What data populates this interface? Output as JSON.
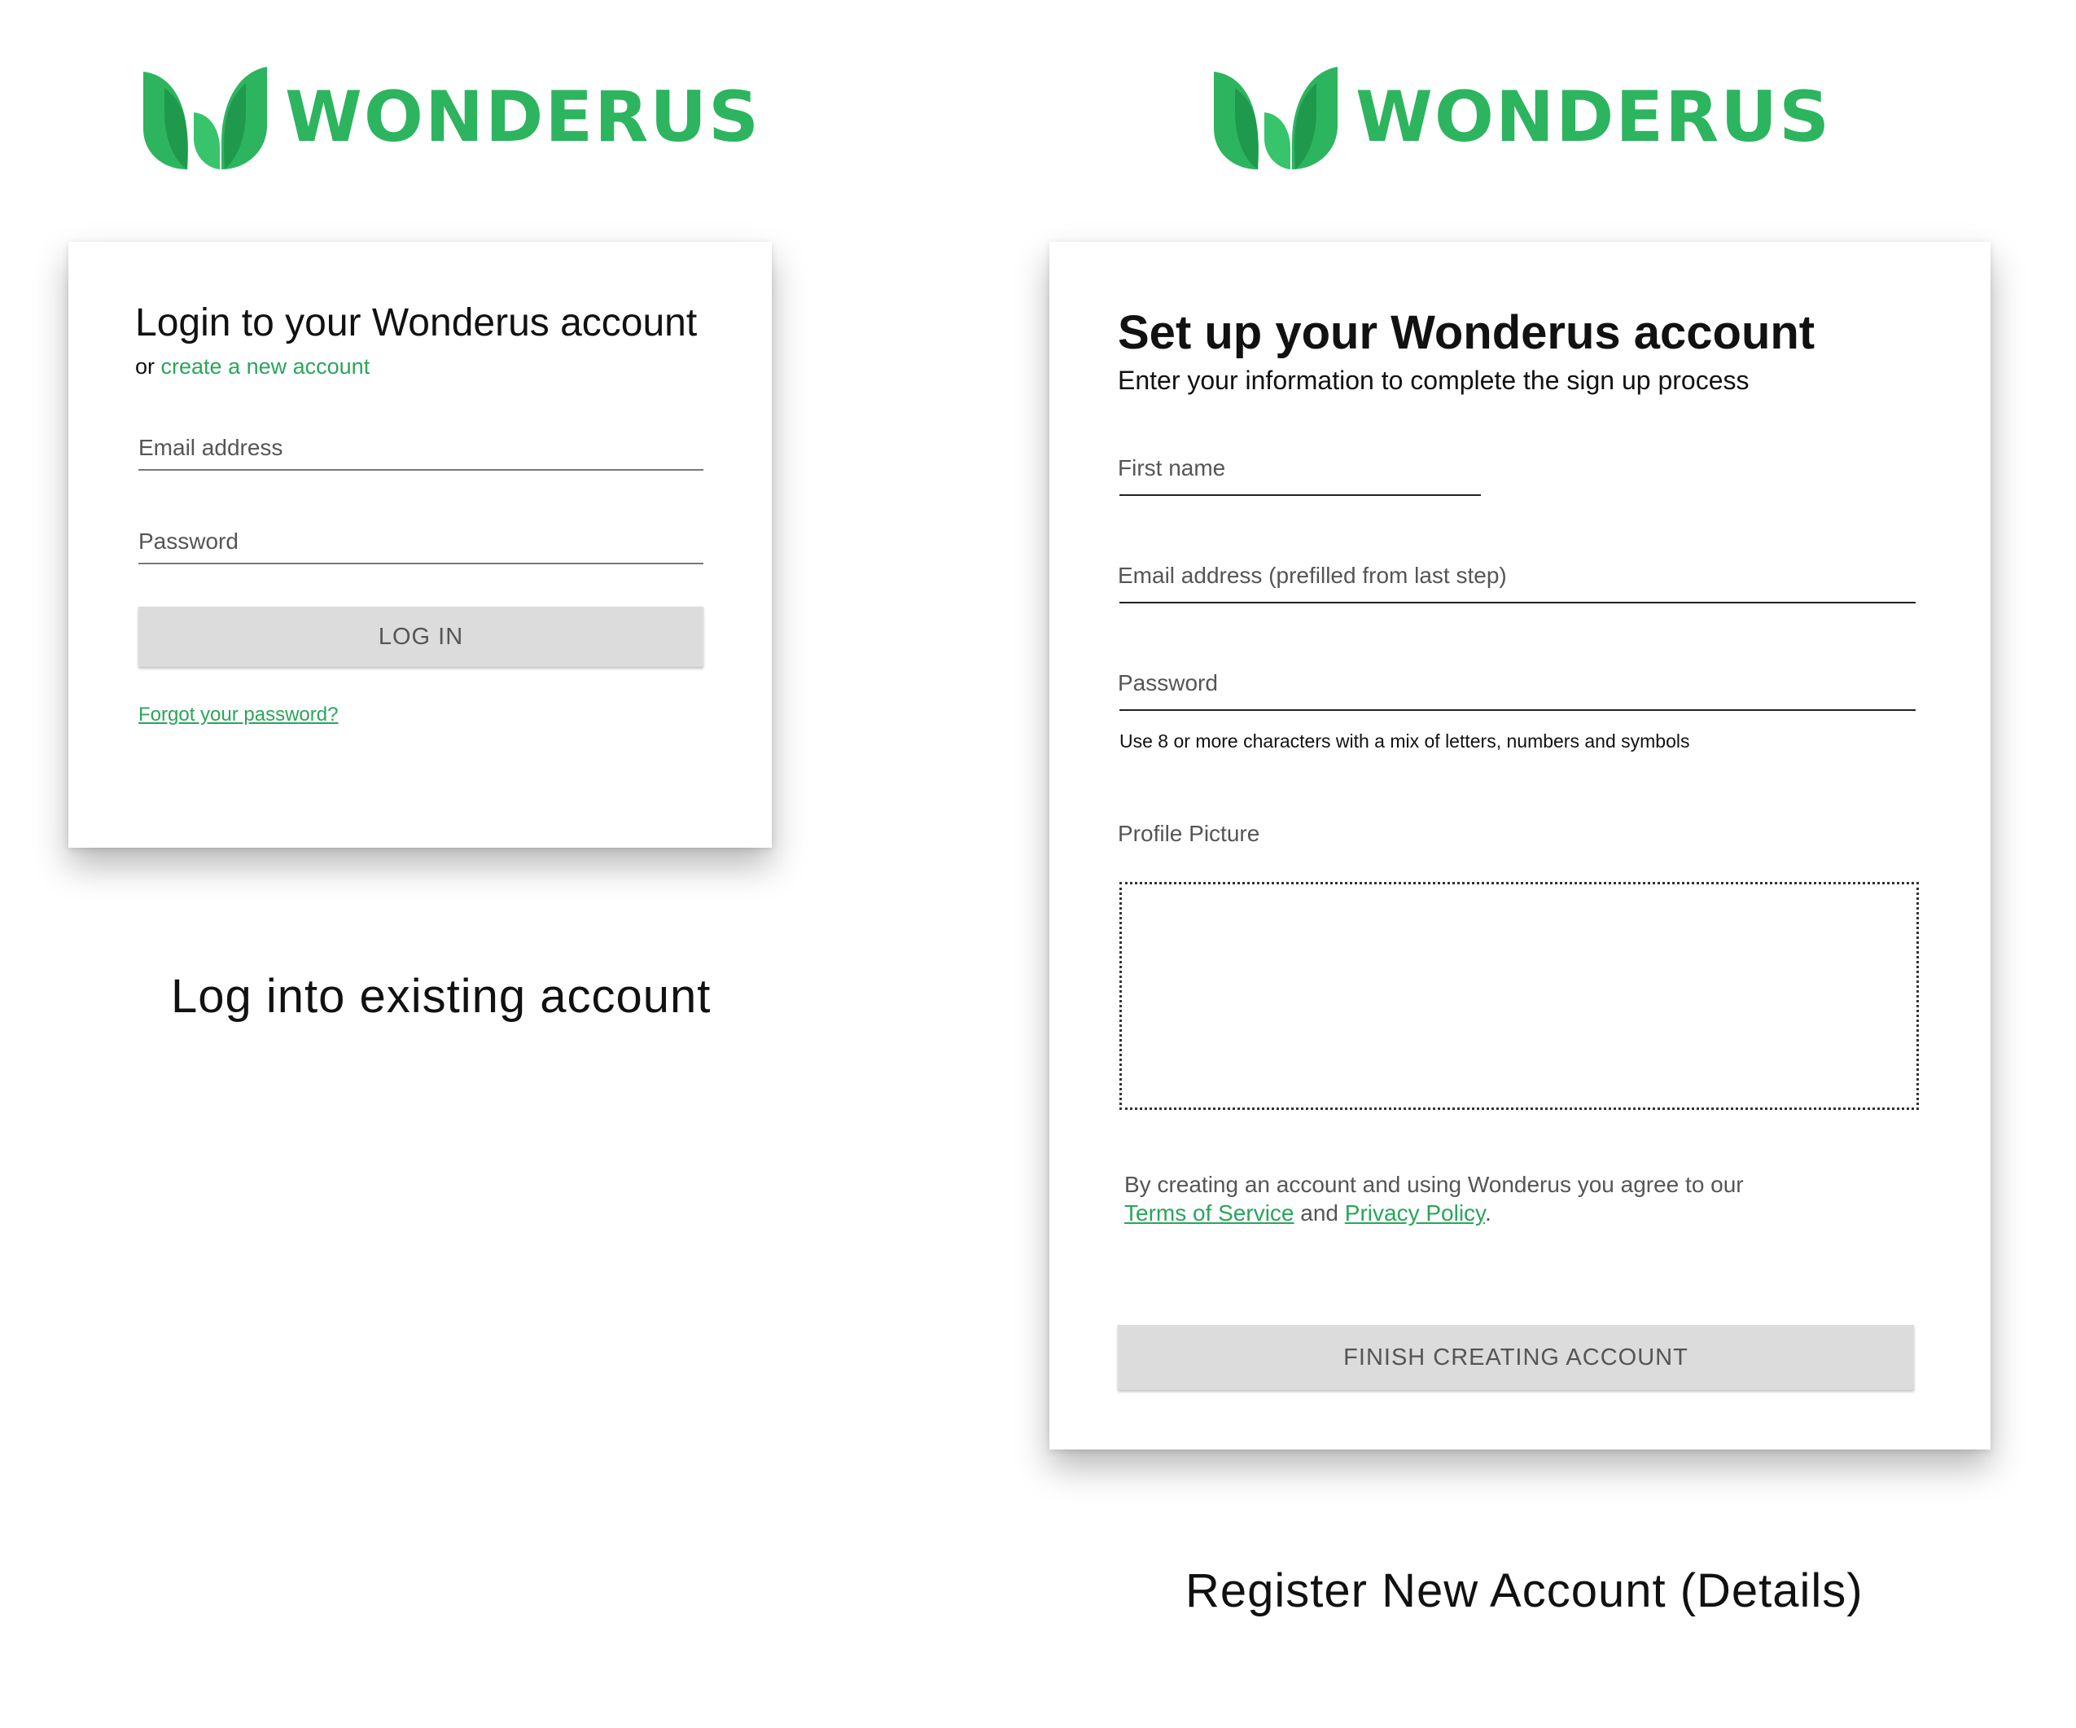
{
  "brand": {
    "name": "WONDERUS",
    "color": "#2db45f"
  },
  "login": {
    "title": "Login to your Wonderus account",
    "or_text": "or",
    "create_link": "create a new account",
    "email_label": "Email address",
    "password_label": "Password",
    "login_button": "LOG IN",
    "forgot_link": "Forgot your password?",
    "caption": "Log into existing account"
  },
  "register": {
    "title": "Set up your Wonderus account",
    "subtitle": "Enter your information to complete the sign up process",
    "first_name_label": "First name",
    "email_label": "Email address (prefilled from last step)",
    "password_label": "Password",
    "password_hint": "Use 8 or more characters with a mix of letters, numbers and symbols",
    "profile_label": "Profile Picture",
    "agree_text": "By creating an account and using Wonderus you agree to our",
    "terms_link": "Terms of Service",
    "and_text": "and",
    "privacy_link": "Privacy Policy",
    "period": ".",
    "finish_button": "FINISH CREATING ACCOUNT",
    "caption": "Register New Account (Details)"
  },
  "icons": [
    "wonderus-logo-icon"
  ]
}
